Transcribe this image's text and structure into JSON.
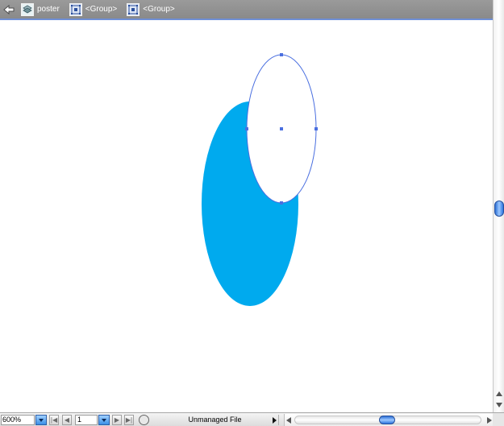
{
  "breadcrumb": {
    "items": [
      {
        "label": "poster",
        "icon": "layer-icon"
      },
      {
        "label": "<Group>",
        "icon": "group-icon"
      },
      {
        "label": "<Group>",
        "icon": "group-icon"
      }
    ]
  },
  "canvas": {
    "fill_color": "#00AAEE",
    "selection_color": "#4A6FE0"
  },
  "statusbar": {
    "zoom_value": "600%",
    "page_value": "1",
    "status_text": "Unmanaged File"
  }
}
